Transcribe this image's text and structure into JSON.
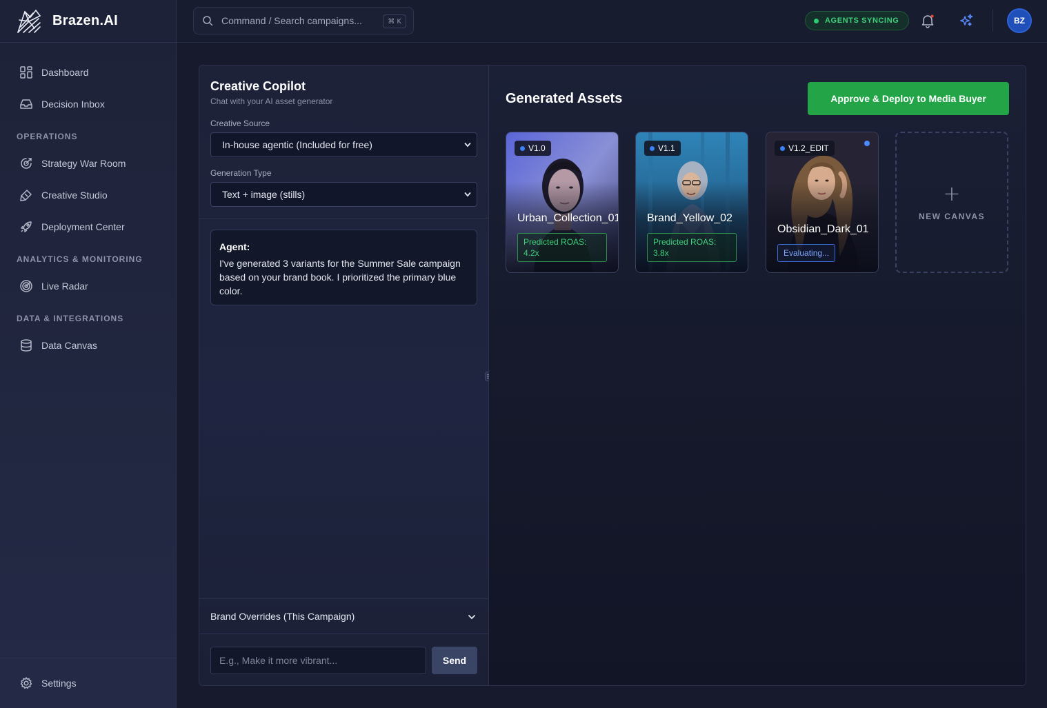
{
  "brand": {
    "name": "Brazen.AI"
  },
  "sidebar": {
    "top_items": [
      {
        "label": "Dashboard",
        "icon": "dashboard-icon"
      },
      {
        "label": "Decision Inbox",
        "icon": "inbox-icon"
      }
    ],
    "sections": [
      {
        "title": "OPERATIONS",
        "items": [
          {
            "label": "Strategy War Room",
            "icon": "strategy-icon"
          },
          {
            "label": "Creative Studio",
            "icon": "brush-icon"
          },
          {
            "label": "Deployment Center",
            "icon": "rocket-icon"
          }
        ]
      },
      {
        "title": "ANALYTICS & MONITORING",
        "items": [
          {
            "label": "Live Radar",
            "icon": "radar-icon"
          }
        ]
      },
      {
        "title": "DATA & INTEGRATIONS",
        "items": [
          {
            "label": "Data Canvas",
            "icon": "database-icon"
          }
        ]
      }
    ],
    "settings": {
      "label": "Settings",
      "icon": "gear-icon"
    }
  },
  "topbar": {
    "search_placeholder": "Command / Search campaigns...",
    "shortcut": "⌘ K",
    "status_badge": "AGENTS SYNCING",
    "avatar_initials": "BZ"
  },
  "copilot": {
    "title": "Creative Copilot",
    "subtitle": "Chat with your AI asset generator",
    "source_label": "Creative Source",
    "source_value": "In-house agentic (Included for free)",
    "type_label": "Generation Type",
    "type_value": "Text + image (stills)",
    "message": {
      "author": "Agent:",
      "text": "I've generated 3 variants for the Summer Sale campaign based on your brand book. I prioritized the primary blue color."
    },
    "overrides_label": "Brand Overrides (This Campaign)",
    "input_placeholder": "E.g., Make it more vibrant...",
    "send_label": "Send"
  },
  "assets": {
    "title": "Generated Assets",
    "deploy_label": "Approve & Deploy to Media Buyer",
    "cards": [
      {
        "version": "V1.0",
        "name": "Urban_Collection_01",
        "status_line1": "Predicted ROAS:",
        "status_line2": "4.2x"
      },
      {
        "version": "V1.1",
        "name": "Brand_Yellow_02",
        "status_line1": "Predicted ROAS:",
        "status_line2": "3.8x"
      },
      {
        "version": "V1.2_EDIT",
        "name": "Obsidian_Dark_01",
        "status": "Evaluating..."
      }
    ],
    "new_canvas_label": "NEW CANVAS",
    "new_canvas_symbol": "+"
  },
  "colors": {
    "accent_green": "#22a447",
    "status_green": "#3fd07a",
    "accent_blue": "#3b82f6",
    "sidebar_bg": "#1e2238",
    "page_bg": "#161a2c"
  }
}
